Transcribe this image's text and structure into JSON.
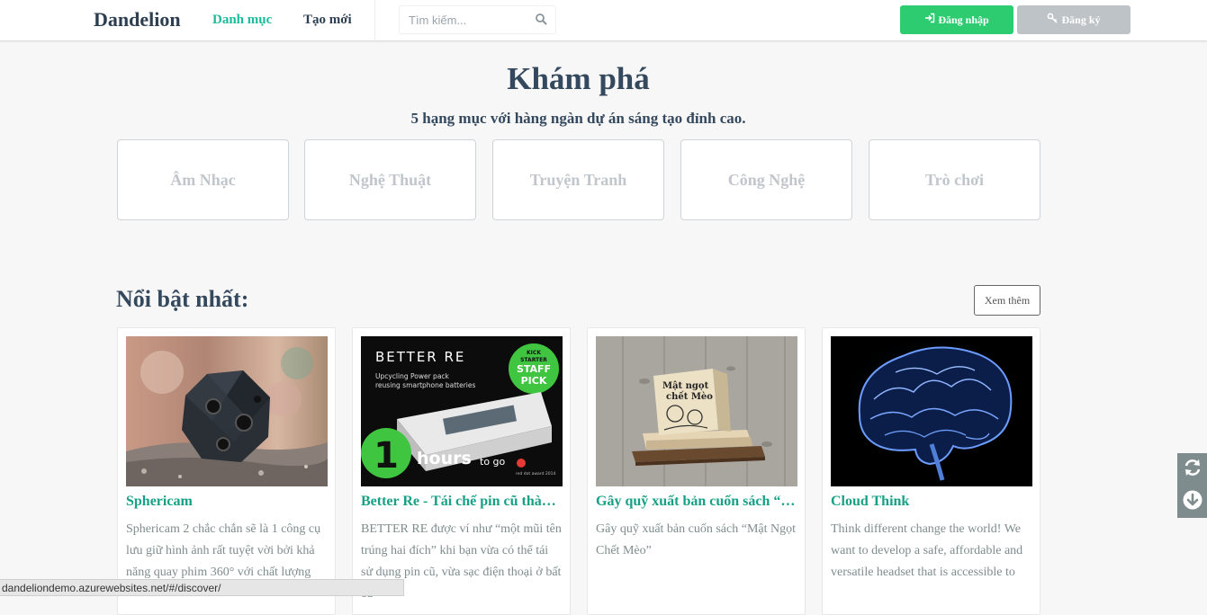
{
  "navbar": {
    "brand": "Dandelion",
    "links": [
      {
        "label": "Danh mục"
      },
      {
        "label": "Tạo mới"
      }
    ],
    "search": {
      "placeholder": "Tìm kiếm...",
      "icon": "search-icon"
    },
    "login_label": "Đăng nhập",
    "register_label": "Đăng ký",
    "colors": {
      "accent": "#1abc9c",
      "login": "#2ecc71",
      "register": "#bdc3c7"
    }
  },
  "hero": {
    "title": "Khám phá",
    "subtitle": "5 hạng mục với hàng ngàn dự án sáng tạo đỉnh cao."
  },
  "categories": [
    {
      "label": "Âm Nhạc"
    },
    {
      "label": "Nghệ Thuật"
    },
    {
      "label": "Truyện Tranh"
    },
    {
      "label": "Công Nghệ"
    },
    {
      "label": "Trò chơi"
    }
  ],
  "featured": {
    "title": "Nổi bật nhất:",
    "more_label": "Xem thêm",
    "cards": [
      {
        "title": "Sphericam",
        "description": "Sphericam 2 chắc chắn sẽ là 1 công cụ lưu giữ hình ảnh rất tuyệt vời bởi khả năng quay phim 360° với chất lượng",
        "image": "sphere-camera-photo"
      },
      {
        "title": "Better Re - Tái chế pin cũ thành...",
        "description": "BETTER RE được ví như “một mũi tên trúng hai đích” khi bạn vừa có thể tái sử dụng pin cũ, vừa sạc điện thoại ở bất cứ",
        "image": "power-pack-photo",
        "image_text": {
          "brand": "BETTER RE",
          "tagline_1": "Upcycling Power pack",
          "tagline_2": "reusing smartphone batteries",
          "badge_1": "KICK",
          "badge_2": "STARTER",
          "badge_3": "STAFF",
          "badge_4": "PICK",
          "count": "1",
          "countdown": "hours",
          "countdown_suffix": "to go",
          "award": "red dot award 2014"
        }
      },
      {
        "title": "Gây quỹ xuất bản cuốn sách “M...",
        "description": "Gây quỹ xuất bản cuốn sách “Mật Ngọt Chết Mèo”",
        "image": "book-on-shelf-photo",
        "image_text": {
          "book_line_1": "Mật ngọt",
          "book_line_2": "chết Mèo"
        }
      },
      {
        "title": "Cloud Think",
        "description": "Think different change the world! We want to develop a safe, affordable and versatile headset that is accessible to",
        "image": "brain-scan-photo"
      }
    ]
  },
  "side_tools": [
    {
      "icon": "refresh-icon"
    },
    {
      "icon": "arrow-down-circle-icon"
    }
  ],
  "status_url": "dandeliondemo.azurewebsites.net/#/discover/"
}
